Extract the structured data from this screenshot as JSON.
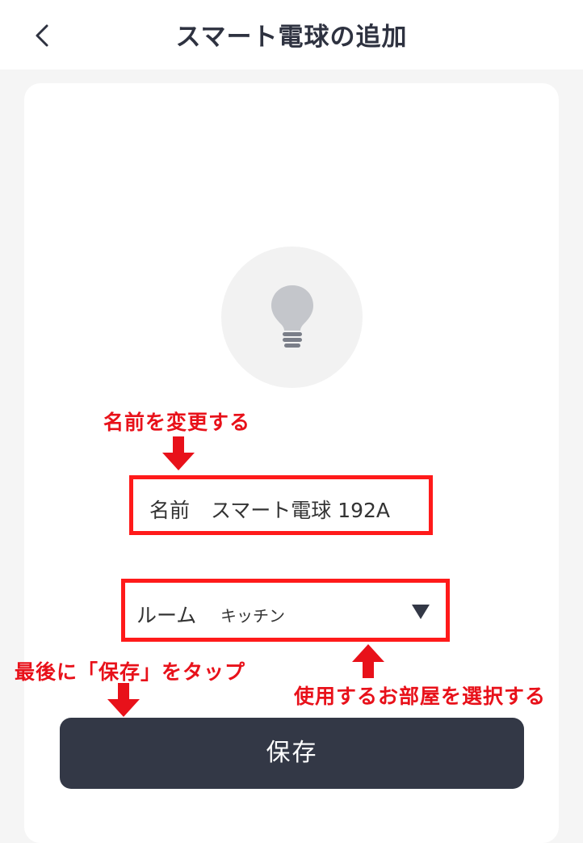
{
  "header": {
    "title": "スマート電球の追加",
    "back_icon": "chevron-left-icon"
  },
  "device": {
    "icon": "light-bulb-icon"
  },
  "form": {
    "name_label": "名前",
    "name_value": "スマート電球 192A",
    "room_label": "ルーム",
    "room_value": "キッチン",
    "room_dropdown_icon": "triangle-down-icon"
  },
  "actions": {
    "save_label": "保存"
  },
  "annotations": {
    "change_name": "名前を変更する",
    "select_room": "使用するお部屋を選択する",
    "tap_save": "最後に「保存」をタップ",
    "color": "#e8111a"
  },
  "colors": {
    "header_bg": "#ffffff",
    "page_bg": "#f5f5f5",
    "button_bg": "#333846",
    "highlight_border": "#ff1a1a"
  }
}
